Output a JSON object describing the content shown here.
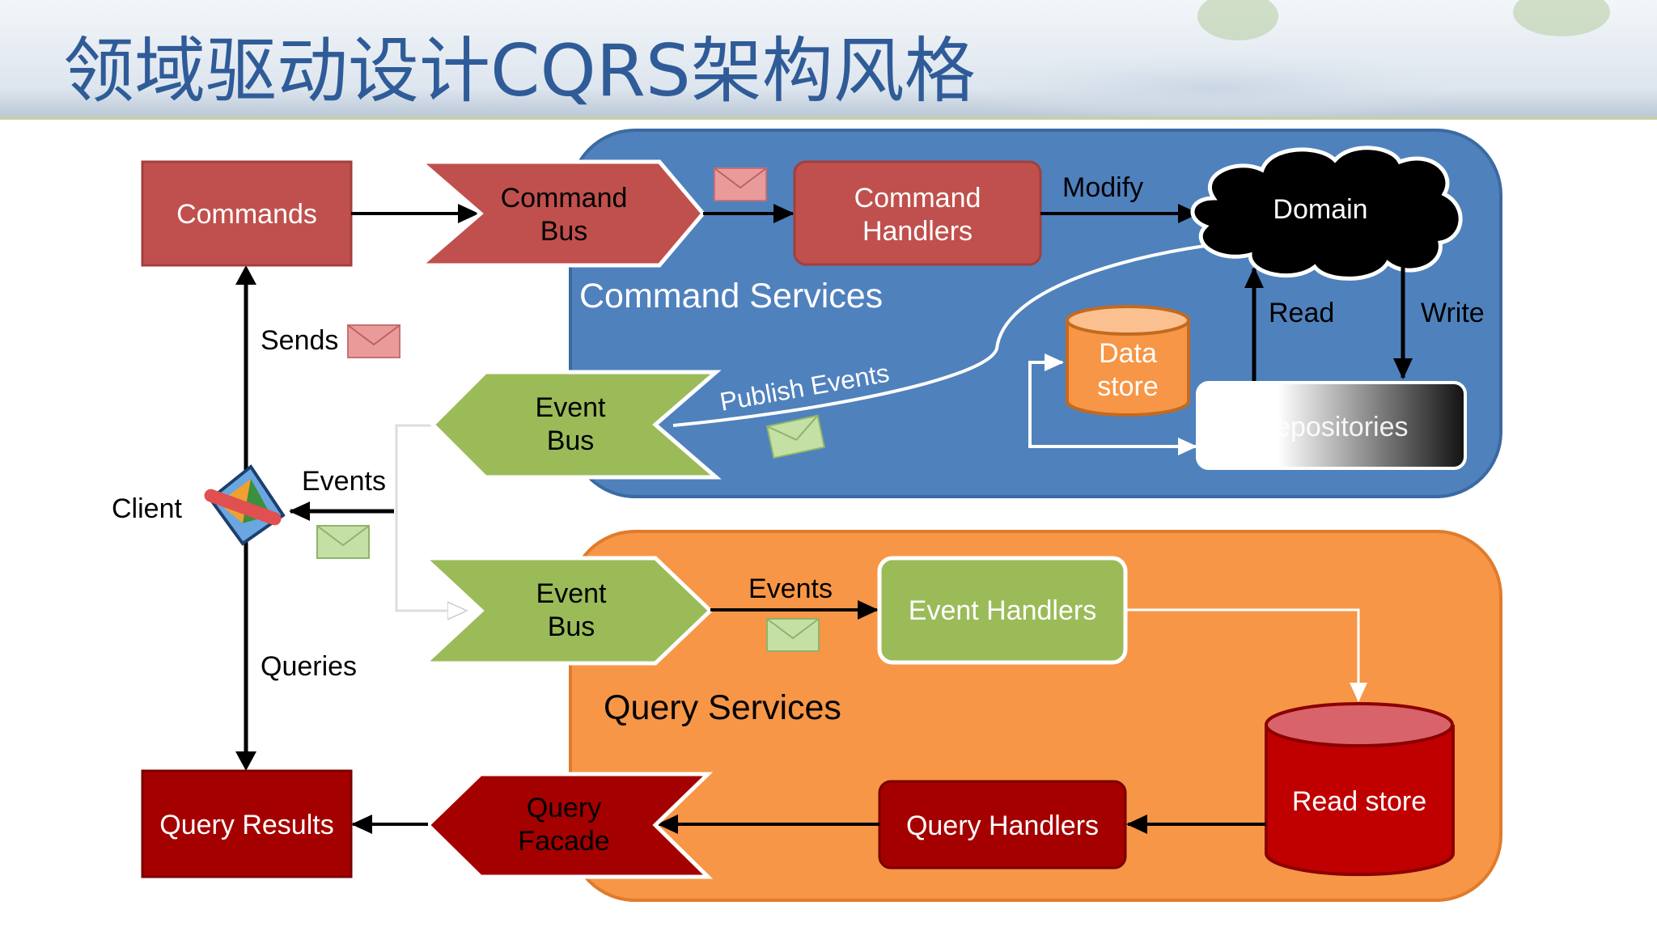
{
  "title": "领域驱动设计CQRS架构风格",
  "colors": {
    "title": "#2f5c98",
    "command_region": "#4f81bd",
    "query_region": "#f79646",
    "command_box": "#c0504d",
    "event_bus": "#9bbb59",
    "query_box": "#a50000"
  },
  "client": {
    "label": "Client",
    "icon": "client-app-icon",
    "sends": "Sends",
    "events": "Events",
    "queries": "Queries"
  },
  "command_side": {
    "commands": "Commands",
    "command_bus": [
      "Command",
      "Bus"
    ],
    "command_handlers": [
      "Command",
      "Handlers"
    ],
    "modify": "Modify",
    "domain": "Domain",
    "region_title": "Command Services",
    "read": "Read",
    "write": "Write",
    "data_store": [
      "Data",
      "store"
    ],
    "repositories": "Repositories",
    "publish_events": "Publish Events",
    "event_bus": [
      "Event",
      "Bus"
    ]
  },
  "query_side": {
    "event_bus": [
      "Event",
      "Bus"
    ],
    "events": "Events",
    "event_handlers": "Event Handlers",
    "region_title": "Query Services",
    "read_store": "Read store",
    "query_handlers": "Query Handlers",
    "query_facade": [
      "Query",
      "Facade"
    ],
    "query_results": "Query Results"
  }
}
